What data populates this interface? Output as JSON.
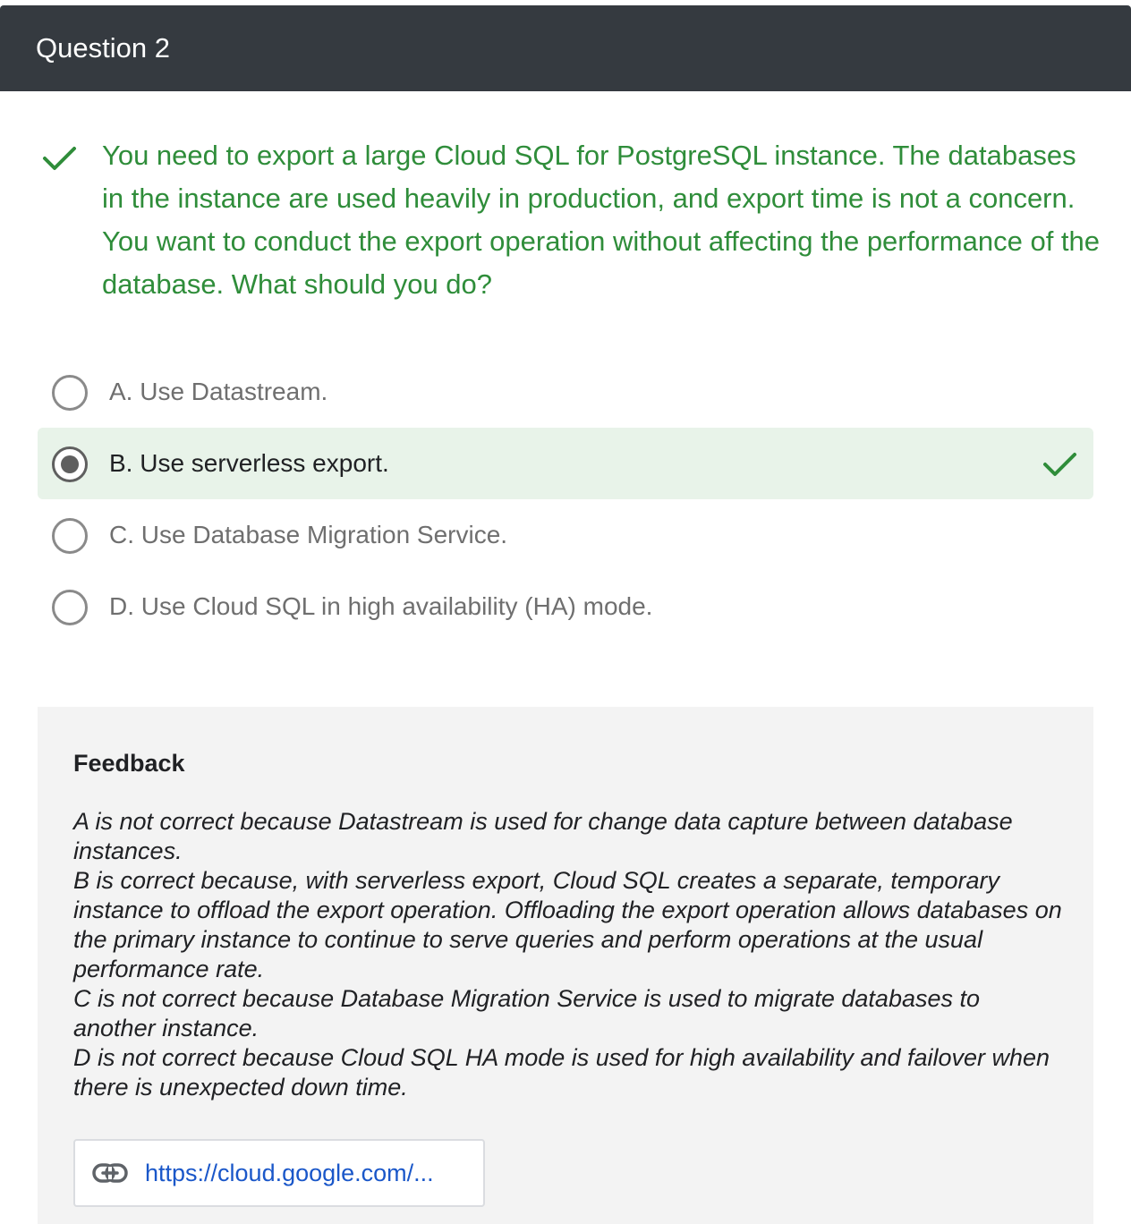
{
  "header": {
    "title": "Question 2"
  },
  "question": {
    "status_icon": "check-icon",
    "text": "You need to export a large Cloud SQL for PostgreSQL instance. The databases in the instance are used heavily in production, and export time is not a concern. You want to conduct the export operation without affecting the performance of the database. What should you do?"
  },
  "options": [
    {
      "label": "A. Use Datastream.",
      "selected": false
    },
    {
      "label": "B. Use serverless export.",
      "selected": true,
      "correct": true
    },
    {
      "label": "C. Use Database Migration Service.",
      "selected": false
    },
    {
      "label": "D. Use Cloud SQL in high availability (HA) mode.",
      "selected": false
    }
  ],
  "feedback": {
    "title": "Feedback",
    "lines": [
      "A is not correct because Datastream is used for change data capture between database instances.",
      "B is correct because, with serverless export, Cloud SQL creates a separate, temporary instance to offload the export operation. Offloading the export operation allows databases on the primary instance to continue to serve queries and perform operations at the usual performance rate.",
      "C is not correct because Database Migration Service is used to migrate databases to another instance.",
      "D is not correct because Cloud SQL HA mode is used for high availability and failover when there is unexpected down time."
    ],
    "link": {
      "icon": "link-icon",
      "text": "https://cloud.google.com/..."
    }
  },
  "colors": {
    "header_bg": "#353a40",
    "correct_green": "#2f8d3a",
    "selected_bg": "#e8f3e9",
    "feedback_bg": "#f3f3f3",
    "link_blue": "#1a57c9"
  }
}
